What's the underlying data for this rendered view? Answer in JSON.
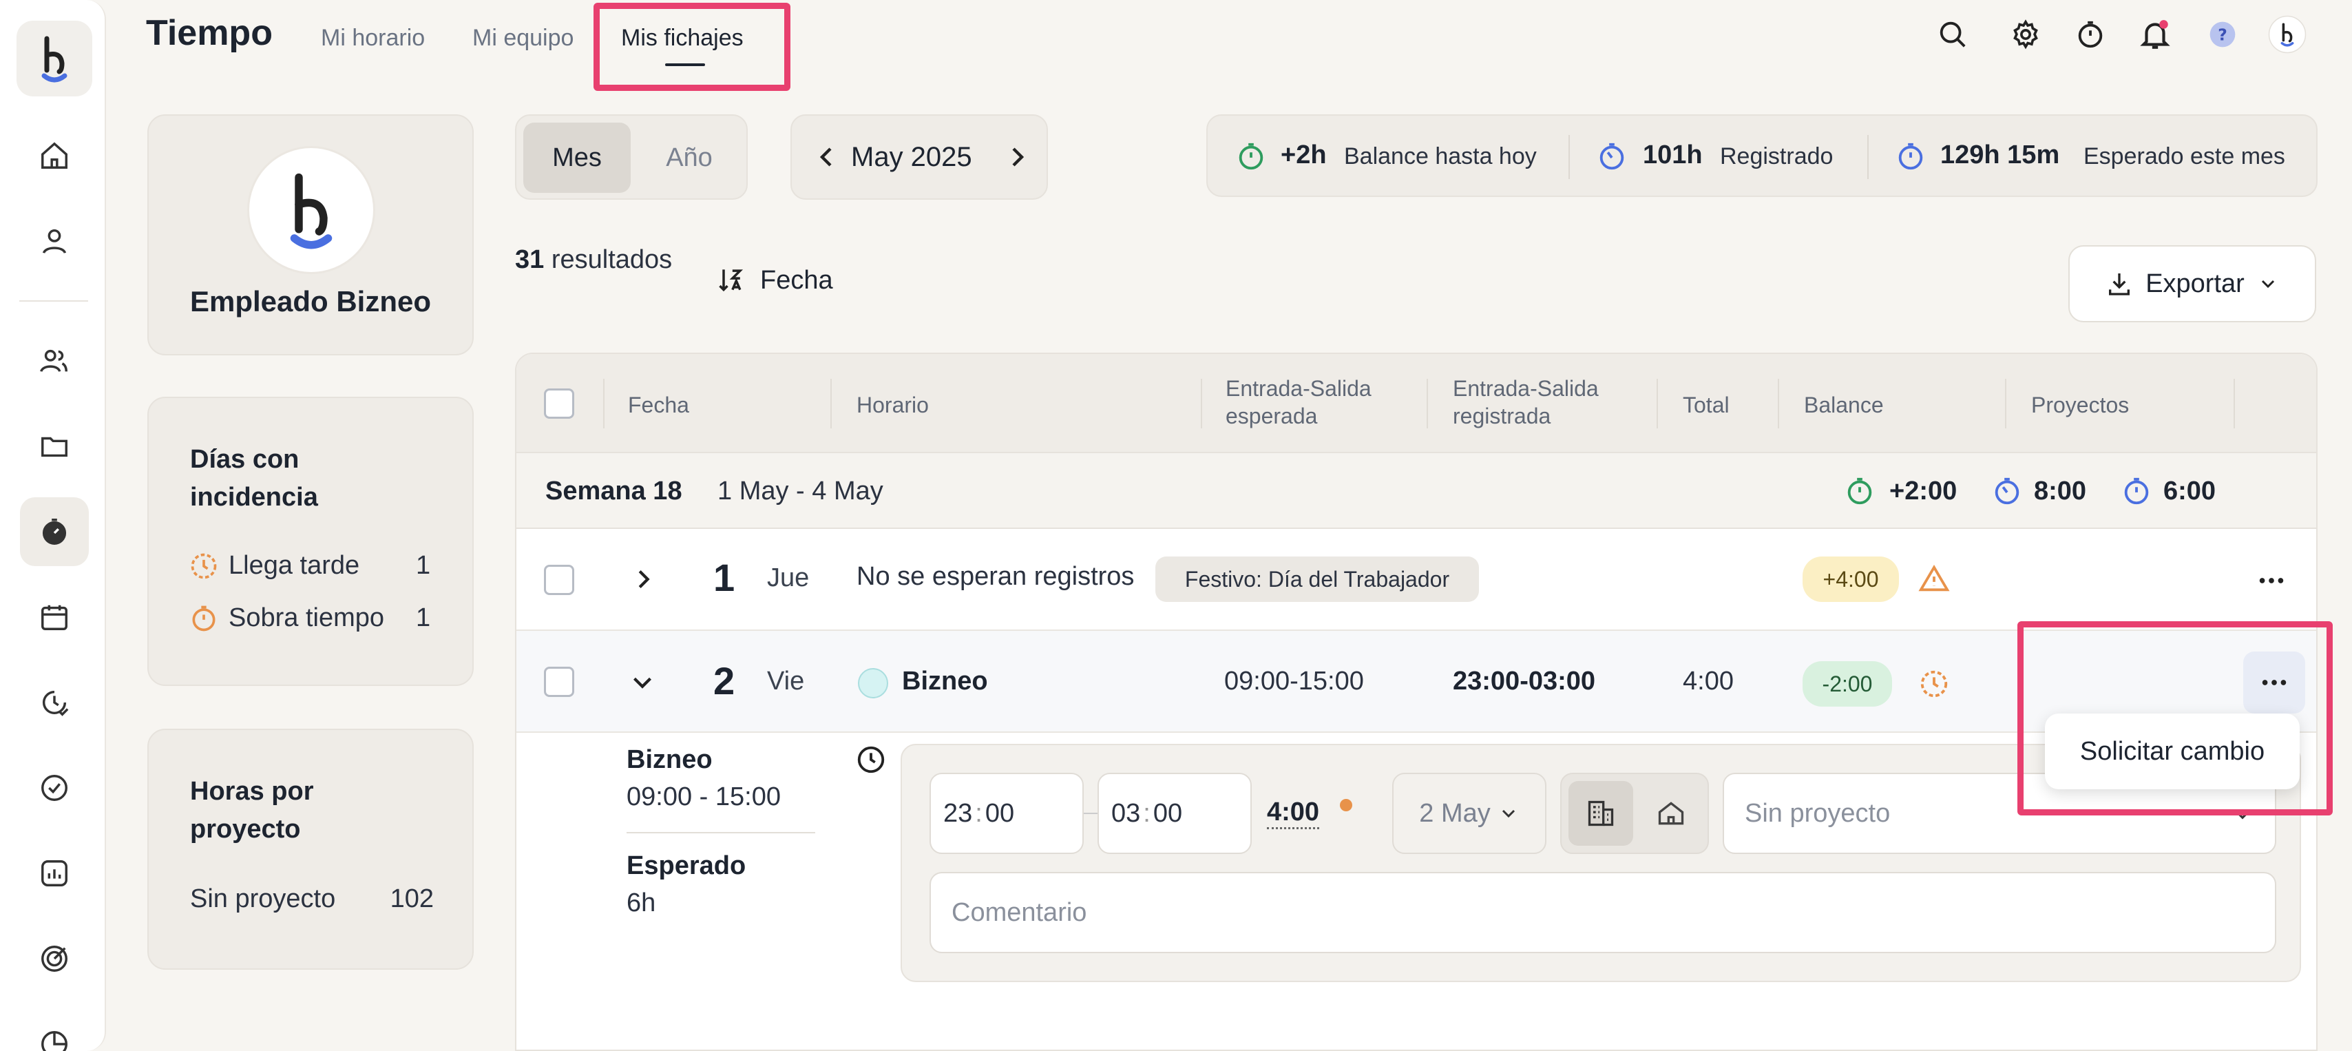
{
  "header": {
    "title": "Tiempo",
    "tabs": [
      {
        "label": "Mi horario"
      },
      {
        "label": "Mi equipo"
      },
      {
        "label": "Mis fichajes"
      }
    ]
  },
  "profile": {
    "name": "Empleado Bizneo"
  },
  "incidents": {
    "title": "Días con incidencia",
    "items": [
      {
        "label": "Llega tarde",
        "count": "1"
      },
      {
        "label": "Sobra tiempo",
        "count": "1"
      }
    ]
  },
  "projects_card": {
    "title": "Horas por proyecto",
    "items": [
      {
        "label": "Sin proyecto",
        "value": "102"
      }
    ]
  },
  "view_toggle": {
    "month": "Mes",
    "year": "Año"
  },
  "month_nav": {
    "label": "May 2025"
  },
  "summary": {
    "balance_value": "+2h",
    "balance_label": "Balance hasta hoy",
    "registered_value": "101h",
    "registered_label": "Registrado",
    "expected_value": "129h 15m",
    "expected_label": "Esperado este mes"
  },
  "results": {
    "count": "31",
    "label": "resultados",
    "sort_label": "Fecha"
  },
  "export": {
    "label": "Exportar"
  },
  "table": {
    "columns": [
      "Fecha",
      "Horario",
      "Entrada-Salida esperada",
      "Entrada-Salida registrada",
      "Total",
      "Balance",
      "Proyectos"
    ],
    "week": {
      "label": "Semana 18",
      "range": "1 May - 4 May",
      "balance": "+2:00",
      "registered": "8:00",
      "expected": "6:00"
    },
    "rows": [
      {
        "day": "1",
        "weekday": "Jue",
        "schedule": "No se esperan registros",
        "badge": "Festivo: Día del Trabajador",
        "balance": "+4:00"
      },
      {
        "day": "2",
        "weekday": "Vie",
        "schedule": "Bizneo",
        "expected": "09:00-15:00",
        "registered": "23:00-03:00",
        "total": "4:00",
        "balance": "-2:00"
      }
    ]
  },
  "detail": {
    "schedule_name": "Bizneo",
    "schedule_hours": "09:00 - 15:00",
    "expected_label": "Esperado",
    "expected_value": "6h",
    "start_h": "23",
    "start_m": "00",
    "end_h": "03",
    "end_m": "00",
    "total": "4:00",
    "date": "2 May",
    "project_placeholder": "Sin proyecto",
    "comment_placeholder": "Comentario"
  },
  "context_menu": {
    "item": "Solicitar cambio"
  },
  "colors": {
    "highlight": "#e8406f",
    "accent_blue": "#4a6fe0",
    "positive_green": "#2e9c5e",
    "warning_orange": "#e8924a"
  }
}
